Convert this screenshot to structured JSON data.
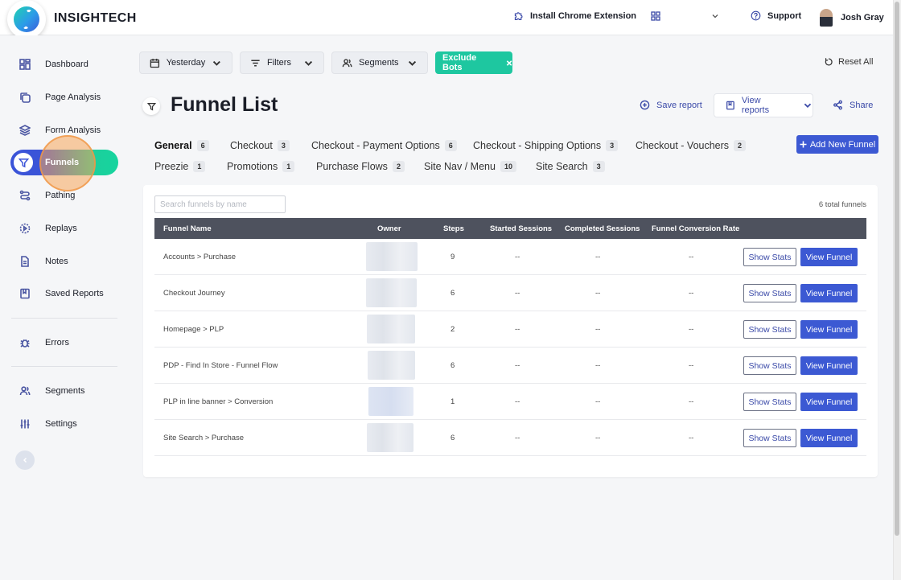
{
  "app": {
    "brand": "INSIGHTECH"
  },
  "topbar": {
    "install_extension": "Install Chrome Extension",
    "support": "Support",
    "user_name": "Josh Gray"
  },
  "sidebar": {
    "items": [
      {
        "label": "Dashboard",
        "icon": "dashboard-icon"
      },
      {
        "label": "Page Analysis",
        "icon": "page-analysis-icon"
      },
      {
        "label": "Form Analysis",
        "icon": "form-analysis-icon"
      },
      {
        "label": "Funnels",
        "icon": "funnel-icon",
        "active": true
      },
      {
        "label": "Pathing",
        "icon": "pathing-icon"
      },
      {
        "label": "Replays",
        "icon": "replay-icon"
      },
      {
        "label": "Notes",
        "icon": "notes-icon"
      },
      {
        "label": "Saved Reports",
        "icon": "saved-reports-icon"
      },
      {
        "label": "Errors",
        "icon": "bug-icon"
      },
      {
        "label": "Segments",
        "icon": "segments-icon"
      },
      {
        "label": "Settings",
        "icon": "sliders-icon"
      }
    ]
  },
  "filters": {
    "date": "Yesterday",
    "filters": "Filters",
    "segments": "Segments",
    "exclude_bots": "Exclude Bots",
    "reset_all": "Reset All"
  },
  "page": {
    "title": "Funnel List",
    "save_report": "Save report",
    "view_reports": "View reports",
    "share": "Share",
    "add_funnel": "Add New Funnel"
  },
  "tabs": [
    {
      "label": "General",
      "count": "6",
      "active": true
    },
    {
      "label": "Checkout",
      "count": "3"
    },
    {
      "label": "Checkout - Payment Options",
      "count": "6"
    },
    {
      "label": "Checkout - Shipping Options",
      "count": "3"
    },
    {
      "label": "Checkout - Vouchers",
      "count": "2"
    },
    {
      "label": "Preezie",
      "count": "1"
    },
    {
      "label": "Promotions",
      "count": "1"
    },
    {
      "label": "Purchase Flows",
      "count": "2"
    },
    {
      "label": "Site Nav / Menu",
      "count": "10"
    },
    {
      "label": "Site Search",
      "count": "3"
    }
  ],
  "table": {
    "search_placeholder": "Search funnels by name",
    "total": "6 total funnels",
    "columns": [
      "Funnel Name",
      "Owner",
      "Steps",
      "Started Sessions",
      "Completed Sessions",
      "Funnel Conversion Rate"
    ],
    "show_stats_label": "Show Stats",
    "view_funnel_label": "View Funnel",
    "rows": [
      {
        "name": "Accounts > Purchase",
        "steps": "9",
        "started": "--",
        "completed": "--",
        "rate": "--"
      },
      {
        "name": "Checkout Journey",
        "steps": "6",
        "started": "--",
        "completed": "--",
        "rate": "--"
      },
      {
        "name": "Homepage > PLP",
        "steps": "2",
        "started": "--",
        "completed": "--",
        "rate": "--"
      },
      {
        "name": "PDP - Find In Store - Funnel Flow",
        "steps": "6",
        "started": "--",
        "completed": "--",
        "rate": "--"
      },
      {
        "name": "PLP in line banner > Conversion",
        "steps": "1",
        "started": "--",
        "completed": "--",
        "rate": "--"
      },
      {
        "name": "Site Search > Purchase",
        "steps": "6",
        "started": "--",
        "completed": "--",
        "rate": "--"
      }
    ]
  },
  "colors": {
    "primary": "#3c59d3",
    "accent": "#1ec7a0",
    "header": "#4e525e"
  }
}
